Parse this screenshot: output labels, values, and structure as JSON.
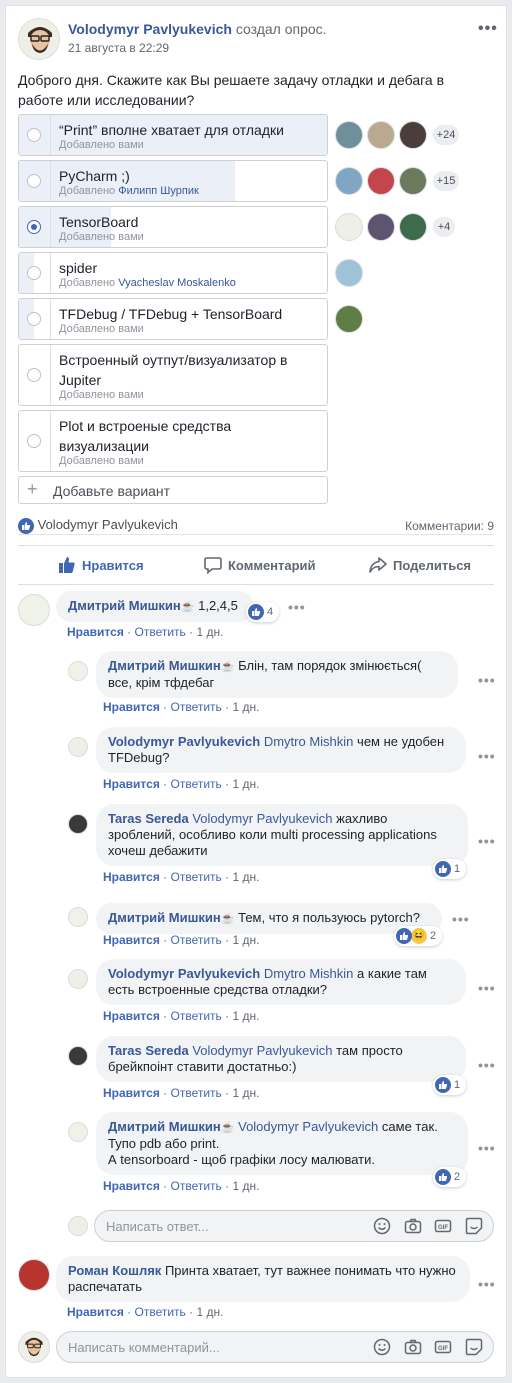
{
  "post": {
    "author": "Volodymyr Pavlyukevich",
    "action": "создал опрос.",
    "time": "21 августа в 22:29",
    "text": "Доброго дня. Скажите как Вы решаете задачу отладки и дебага в работе или исследовании?"
  },
  "poll": {
    "options": [
      {
        "label": "“Print” вполне хватает для отладки",
        "added_prefix": "Добавлено вами",
        "added_by": "",
        "selected": false,
        "share": 1.0,
        "extra": "+24"
      },
      {
        "label": "PyCharm ;)",
        "added_prefix": "Добавлено",
        "added_by": "Филипп Шурпик",
        "selected": false,
        "share": 0.7,
        "extra": "+15"
      },
      {
        "label": "TensorBoard",
        "added_prefix": "Добавлено вами",
        "added_by": "",
        "selected": true,
        "share": 0.3,
        "extra": "+4"
      },
      {
        "label": "spider",
        "added_prefix": "Добавлено",
        "added_by": "Vyacheslav Moskalenko",
        "selected": false,
        "share": 0.05,
        "extra": ""
      },
      {
        "label": "TFDebug / TFDebug + TensorBoard",
        "added_prefix": "Добавлено вами",
        "added_by": "",
        "selected": false,
        "share": 0.05,
        "extra": ""
      },
      {
        "label": "Встроенный оутпут/визуализатор в Jupiter",
        "added_prefix": "Добавлено вами",
        "added_by": "",
        "selected": false,
        "share": 0.0,
        "extra": ""
      },
      {
        "label": "Plot и встроеные средства визуализации",
        "added_prefix": "Добавлено вами",
        "added_by": "",
        "selected": false,
        "share": 0.0,
        "extra": ""
      }
    ],
    "add_option": "Добавьте вариант"
  },
  "summary": {
    "liker": "Volodymyr Pavlyukevich",
    "comments": "Комментарии: 9"
  },
  "actions": {
    "like": "Нравится",
    "comment": "Комментарий",
    "share": "Поделиться"
  },
  "meta": {
    "like": "Нравится",
    "reply": "Ответить",
    "sep": "·"
  },
  "comments": [
    {
      "name": "Дмитрий Мишкин",
      "cup": "☕",
      "tag": "",
      "text": "1,2,4,5",
      "time": "1 дн.",
      "reactions": "4"
    },
    {
      "name": "Дмитрий Мишкин",
      "cup": "☕",
      "tag": "",
      "text": "Блін, там порядок змінюється( все, крім тфдебаг",
      "time": "1 дн.",
      "reactions": ""
    },
    {
      "name": "Volodymyr Pavlyukevich",
      "cup": "",
      "tag": "Dmytro Mishkin",
      "text": "чем не удобен TFDebug?",
      "time": "1 дн.",
      "reactions": ""
    },
    {
      "name": "Taras Sereda",
      "cup": "",
      "tag": "Volodymyr Pavlyukevich",
      "text": "жахливо зроблений, особливо коли multi processing applications хочеш дебажити",
      "time": "1 дн.",
      "reactions": "1"
    },
    {
      "name": "Дмитрий Мишкин",
      "cup": "☕",
      "tag": "",
      "text": "Тем, что я пользуюсь pytorch?",
      "time": "1 дн.",
      "reactions": "2"
    },
    {
      "name": "Volodymyr Pavlyukevich",
      "cup": "",
      "tag": "Dmytro Mishkin",
      "text": "а какие там есть встроенные средства отладки?",
      "time": "1 дн.",
      "reactions": ""
    },
    {
      "name": "Taras Sereda",
      "cup": "",
      "tag": "Volodymyr Pavlyukevich",
      "text": "там просто брейкпоінт ставити достатньо:)",
      "time": "1 дн.",
      "reactions": "1"
    },
    {
      "name": "Дмитрий Мишкин",
      "cup": "☕",
      "tag": "Volodymyr Pavlyukevich",
      "text": "саме так.",
      "text2": "Тупо pdb або print.",
      "text3": "А tensorboard - щоб графіки лосу малювати.",
      "time": "1 дн.",
      "reactions": "2"
    },
    {
      "name": "Роман Кошляк",
      "cup": "",
      "tag": "",
      "text": "Принта хватает, тут важнее понимать что нужно распечатать",
      "time": "1 дн.",
      "reactions": ""
    }
  ],
  "reply_placeholder": "Написать ответ...",
  "comment_placeholder": "Написать комментарий...",
  "colors": {
    "accent": "#4267b2",
    "link": "#385898",
    "bubble": "#f2f3f5"
  }
}
